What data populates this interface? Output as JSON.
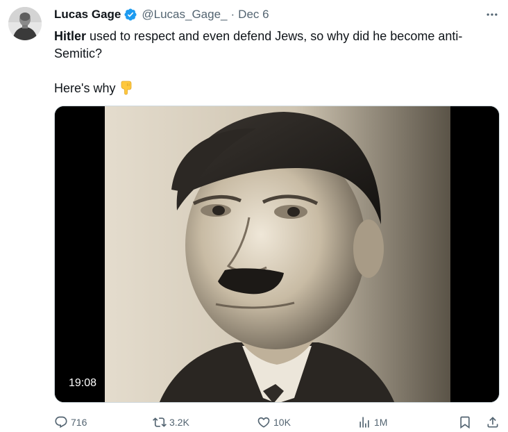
{
  "tweet": {
    "author": {
      "display_name": "Lucas Gage",
      "handle": "@Lucas_Gage_",
      "separator": "·",
      "date": "Dec 6",
      "verified": true
    },
    "text": {
      "bold_word": "Hitler",
      "line1_rest": " used to respect and even defend Jews, so why did he become anti-Semitic?",
      "line2": "Here's why",
      "emoji": "👇"
    },
    "media": {
      "type": "video",
      "duration": "19:08"
    },
    "actions": {
      "replies": "716",
      "reposts": "3.2K",
      "likes": "10K",
      "views": "1M"
    }
  },
  "colors": {
    "text_primary": "#0f1419",
    "text_secondary": "#536471",
    "verified_blue": "#1d9bf0"
  },
  "icons": [
    "more-icon",
    "verified-icon",
    "reply-icon",
    "repost-icon",
    "like-icon",
    "views-icon",
    "bookmark-icon",
    "share-icon"
  ]
}
